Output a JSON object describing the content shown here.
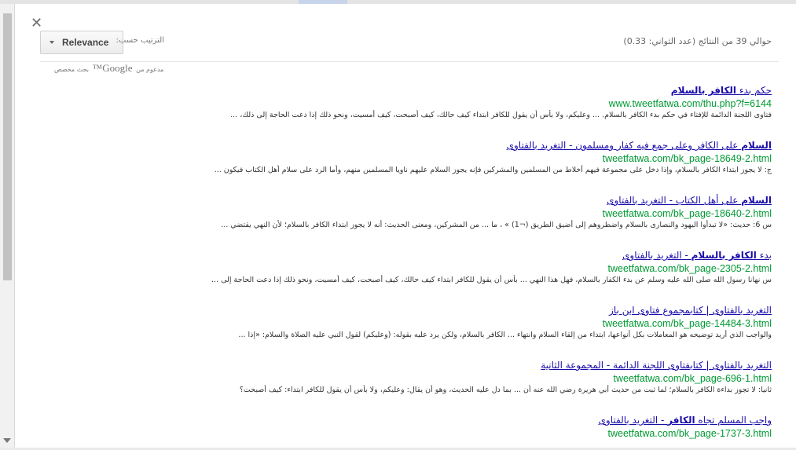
{
  "dialog": {
    "close_label": "✕"
  },
  "toolbar": {
    "results_count": "حوالي 39 من النتائج (عدد الثواني: 0.33)",
    "sort_label": "الترتيب حسب:",
    "sort_value": "Relevance"
  },
  "branding": {
    "powered_prefix": "مدعوم من",
    "google": "Google™",
    "powered_suffix": "بحث مخصص"
  },
  "results": [
    {
      "title_plain_1": "حكم بدء ",
      "title_bold": "الكافر بالسلام",
      "title_plain_2": "",
      "url": "www.tweetfatwa.com/thu.php?f=6144",
      "snippet": "فتاوى اللجنة الدائمة للإفتاء في حكم بدء الكافر بالسلام. ... وعليكم، ولا بأس أن يقول للكافر ابتداء كيف حالك، كيف أصبحت، كيف أمسيت، ونحو ذلك إذا دعت الحاجة إلى ذلك، ..."
    },
    {
      "title_plain_1": "",
      "title_bold": "السلام",
      "title_plain_2": " على الكافر وعلى جمع فيه كفار ومسلمون - التغريد بالفتاوى",
      "url": "tweetfatwa.com/bk_page-18649-2.html",
      "snippet": "ج: لا يجوز ابتداء الكافر بالسلام، وإذا دخل على مجموعة فيهم أخلاط من المسلمين والمشركين فإنه يجوز السلام عليهم ناويا المسلمين منهم، وأما الرد على سلام أهل الكتاب فيكون ..."
    },
    {
      "title_plain_1": "",
      "title_bold": "السلام",
      "title_plain_2": " على أهل الكتاب - التغريد بالفتاوى",
      "url": "tweetfatwa.com/bk_page-18640-2.html",
      "snippet": "س 6: حديث: «لا تبدأوا اليهود والنصارى بالسلام واضطروهم إلى أضيق الطريق (¬1) » ، ما ... من المشركين، ومعنى الحديث: أنه لا يجوز ابتداء الكافر بالسلام؛ لأن النهي يقتضي ..."
    },
    {
      "title_plain_1": "بدء ",
      "title_bold": "الكافر بالسلام",
      "title_plain_2": " - التغريد بالفتاوى",
      "url": "tweetfatwa.com/bk_page-2305-2.html",
      "snippet": "س نهانا رسول الله صلى الله عليه وسلم عن بدء الكفار بالسلام، فهل هذا النهي ... بأس أن يقول للكافر ابتداء كيف حالك، كيف أصبحت، كيف أمسيت، ونحو ذلك إذا دعت الحاجة إلى ..."
    },
    {
      "title_plain_1": "التغريد بالفتاوى | كتابمجموع فتاوى ابن باز",
      "title_bold": "",
      "title_plain_2": "",
      "url": "tweetfatwa.com/bk_page-14484-3.html",
      "snippet": "والواجب الذي أريد توضيحه هو المعاملات بكل أنواعها، ابتداء من إلقاء السلام وانتهاء ... الكافر بالسلام، ولكن يرد عليه بقوله: (وعليكم) لقول النبي عليه الصلاة والسلام: «إذا ..."
    },
    {
      "title_plain_1": "التغريد بالفتاوى | كتابفتاوى اللجنة الدائمة - المجموعة الثانية",
      "title_bold": "",
      "title_plain_2": "",
      "url": "tweetfatwa.com/bk_page-696-1.html",
      "snippet": "ثانيا: لا تجوز بداءة الكافر بالسلام؛ لما ثبت من حديث أبي هريرة رضي الله عنه أن ... بما دل عليه الحديث، وهو أن يقال: وعليكم، ولا بأس أن يقول للكافر ابتداء: كيف أصبحت؟"
    },
    {
      "title_plain_1": "واجب المسلم تجاه ",
      "title_bold": "الكافر",
      "title_plain_2": " - التغريد بالفتاوى",
      "url": "tweetfatwa.com/bk_page-1737-3.html",
      "snippet": ""
    }
  ]
}
